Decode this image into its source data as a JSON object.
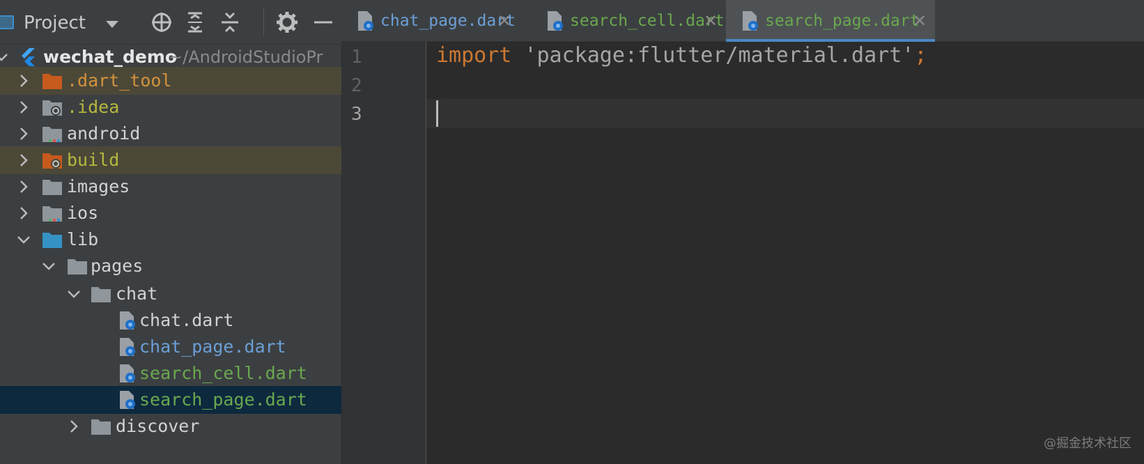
{
  "project_panel": {
    "title": "Project",
    "tools": [
      "locate-icon",
      "expand-all-icon",
      "collapse-all-icon",
      "gear-icon",
      "hide-icon"
    ],
    "tree": {
      "root": {
        "name": "wechat_demo",
        "path": "~/AndroidStudioPr"
      },
      "items": [
        {
          "label": ".dart_tool"
        },
        {
          "label": ".idea"
        },
        {
          "label": "android"
        },
        {
          "label": "build"
        },
        {
          "label": "images"
        },
        {
          "label": "ios"
        },
        {
          "label": "lib"
        },
        {
          "label": "pages"
        },
        {
          "label": "chat"
        },
        {
          "label": "chat.dart"
        },
        {
          "label": "chat_page.dart"
        },
        {
          "label": "search_cell.dart"
        },
        {
          "label": "search_page.dart"
        },
        {
          "label": "discover"
        }
      ]
    }
  },
  "tabs": [
    {
      "label": "chat_page.dart",
      "color": "#6b9fd6",
      "active": false
    },
    {
      "label": "search_cell.dart",
      "color": "#6aa84f",
      "active": false
    },
    {
      "label": "search_page.dart",
      "color": "#6aa84f",
      "active": true
    }
  ],
  "editor": {
    "line_numbers": [
      "1",
      "2",
      "3"
    ],
    "code": {
      "line1_keyword": "import",
      "line1_string": "'package:flutter/material.dart'",
      "line1_semicolon": ";"
    }
  },
  "watermark": "@掘金技术社区"
}
